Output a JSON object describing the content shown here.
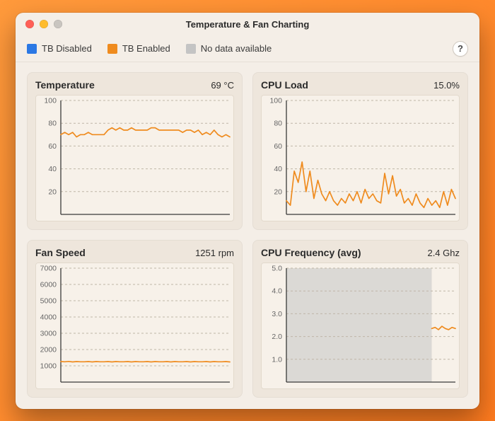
{
  "window": {
    "title": "Temperature & Fan Charting"
  },
  "legend": {
    "tb_disabled": {
      "label": "TB Disabled",
      "color": "#2b78e4"
    },
    "tb_enabled": {
      "label": "TB Enabled",
      "color": "#ef8b1e"
    },
    "no_data": {
      "label": "No data available",
      "color": "#c4c4c4"
    }
  },
  "help": {
    "label": "?"
  },
  "panels": {
    "temperature": {
      "title": "Temperature",
      "value": "69 °C"
    },
    "cpu_load": {
      "title": "CPU Load",
      "value": "15.0%"
    },
    "fan_speed": {
      "title": "Fan Speed",
      "value": "1251 rpm"
    },
    "cpu_freq": {
      "title": "CPU Frequency (avg)",
      "value": "2.4 Ghz"
    }
  },
  "colors": {
    "series": "#ef8b1e"
  },
  "chart_data": [
    {
      "id": "temperature",
      "type": "line",
      "title": "Temperature",
      "ylabel": "",
      "ylim": [
        0,
        100
      ],
      "yticks": [
        20,
        40,
        60,
        80,
        100
      ],
      "series": [
        {
          "name": "TB Enabled",
          "color": "#ef8b1e",
          "values": [
            70,
            72,
            70,
            72,
            68,
            70,
            70,
            72,
            70,
            70,
            70,
            70,
            74,
            76,
            74,
            76,
            74,
            74,
            76,
            74,
            74,
            74,
            74,
            76,
            76,
            74,
            74,
            74,
            74,
            74,
            74,
            72,
            74,
            74,
            72,
            74,
            70,
            72,
            70,
            74,
            70,
            68,
            70,
            68
          ]
        }
      ]
    },
    {
      "id": "cpu_load",
      "type": "line",
      "title": "CPU Load",
      "ylabel": "",
      "ylim": [
        0,
        100
      ],
      "yticks": [
        20,
        40,
        60,
        80,
        100
      ],
      "series": [
        {
          "name": "TB Enabled",
          "color": "#ef8b1e",
          "values": [
            12,
            8,
            38,
            28,
            46,
            20,
            38,
            14,
            30,
            18,
            12,
            20,
            12,
            8,
            14,
            10,
            18,
            12,
            20,
            10,
            22,
            14,
            18,
            12,
            10,
            36,
            18,
            34,
            16,
            22,
            10,
            14,
            8,
            18,
            10,
            6,
            14,
            8,
            12,
            6,
            20,
            8,
            22,
            14
          ]
        }
      ]
    },
    {
      "id": "fan_speed",
      "type": "line",
      "title": "Fan Speed",
      "ylabel": "",
      "ylim": [
        0,
        7000
      ],
      "yticks": [
        1000,
        2000,
        3000,
        4000,
        5000,
        6000,
        7000
      ],
      "series": [
        {
          "name": "TB Enabled",
          "color": "#ef8b1e",
          "values": [
            1260,
            1250,
            1270,
            1240,
            1260,
            1250,
            1250,
            1260,
            1240,
            1260,
            1250,
            1250,
            1260,
            1240,
            1260,
            1250,
            1250,
            1260,
            1240,
            1260,
            1250,
            1250,
            1260,
            1240,
            1260,
            1250,
            1250,
            1260,
            1240,
            1260,
            1250,
            1250,
            1260,
            1240,
            1260,
            1250,
            1250,
            1260,
            1240,
            1260,
            1250,
            1250,
            1260,
            1240
          ]
        }
      ]
    },
    {
      "id": "cpu_freq",
      "type": "line",
      "title": "CPU Frequency (avg)",
      "ylabel": "",
      "ylim": [
        0,
        5.0
      ],
      "yticks": [
        1.0,
        2.0,
        3.0,
        4.0,
        5.0
      ],
      "ytick_format": "fixed1",
      "no_data_range_frac": [
        0.0,
        0.86
      ],
      "series": [
        {
          "name": "TB Enabled",
          "color": "#ef8b1e",
          "x_frac": [
            0.86,
            0.88,
            0.9,
            0.92,
            0.94,
            0.96,
            0.98,
            1.0
          ],
          "values": [
            2.35,
            2.4,
            2.3,
            2.45,
            2.35,
            2.3,
            2.4,
            2.35
          ]
        }
      ]
    }
  ]
}
